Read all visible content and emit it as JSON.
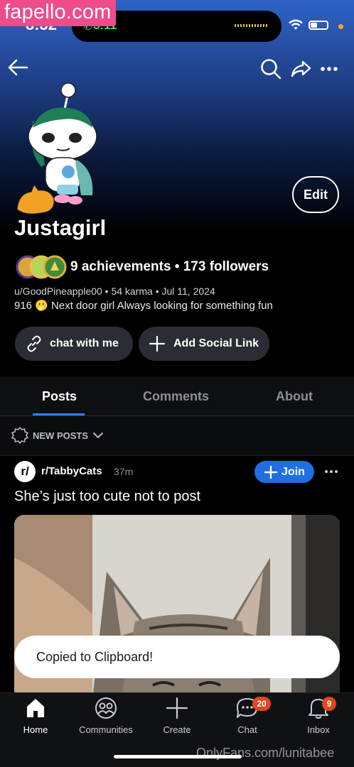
{
  "watermark_top": "fapello.com",
  "watermark_bottom": "OnlyFans.com/lunitabee",
  "status": {
    "time": "8:32",
    "call_time": "3:11"
  },
  "profile": {
    "display_name": "Justagirl",
    "edit_label": "Edit",
    "stats": "9 achievements  • 173 followers",
    "meta": "u/GoodPineapple00 • 54 karma • Jul 11, 2024",
    "bio": "916 🫢   Next door girl  Always looking for something fun",
    "chat_label": "chat with me",
    "social_label": "Add Social Link"
  },
  "tabs": [
    "Posts",
    "Comments",
    "About"
  ],
  "active_tab": "Posts",
  "sort_label": "NEW POSTS",
  "post": {
    "subreddit": "r/TabbyCats",
    "age": "37m",
    "join_label": "Join",
    "title": "She’s just too cute not to post"
  },
  "toast": "Copied to Clipboard!",
  "bottom_nav": [
    {
      "label": "Home",
      "icon": "home-icon",
      "active": true
    },
    {
      "label": "Communities",
      "icon": "communities-icon"
    },
    {
      "label": "Create",
      "icon": "plus-icon"
    },
    {
      "label": "Chat",
      "icon": "chat-icon",
      "badge": "20"
    },
    {
      "label": "Inbox",
      "icon": "bell-icon",
      "badge": "9"
    }
  ],
  "colors": {
    "accent": "#3a7bff",
    "join": "#1f6fe0",
    "badge": "#e0471c",
    "watermark": "#f04b8a"
  }
}
